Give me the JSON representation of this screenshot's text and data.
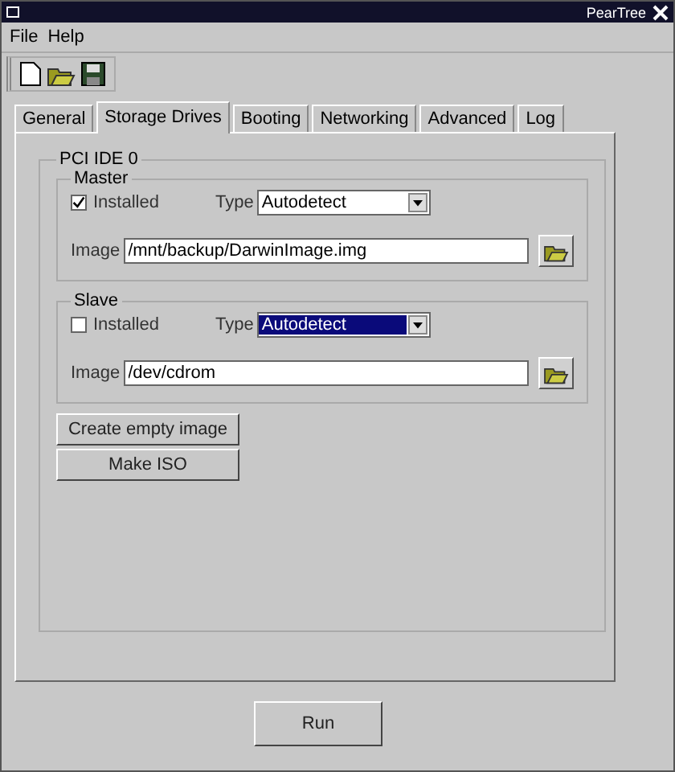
{
  "window": {
    "title": "PearTree"
  },
  "menu": [
    "File",
    "Help"
  ],
  "tabs": [
    {
      "label": "General",
      "selected": false
    },
    {
      "label": "Storage Drives",
      "selected": true
    },
    {
      "label": "Booting",
      "selected": false
    },
    {
      "label": "Networking",
      "selected": false
    },
    {
      "label": "Advanced",
      "selected": false
    },
    {
      "label": "Log",
      "selected": false
    }
  ],
  "group": {
    "title": "PCI IDE 0",
    "drives": [
      {
        "title": "Master",
        "installed_label": "Installed",
        "installed": true,
        "type_label": "Type",
        "type": "Autodetect",
        "type_focused": false,
        "image_label": "Image",
        "image": "/mnt/backup/DarwinImage.img"
      },
      {
        "title": "Slave",
        "installed_label": "Installed",
        "installed": false,
        "type_label": "Type",
        "type": "Autodetect",
        "type_focused": true,
        "image_label": "Image",
        "image": "/dev/cdrom"
      }
    ]
  },
  "buttons": [
    "Create empty image",
    "Make ISO"
  ],
  "run_button": "Run"
}
